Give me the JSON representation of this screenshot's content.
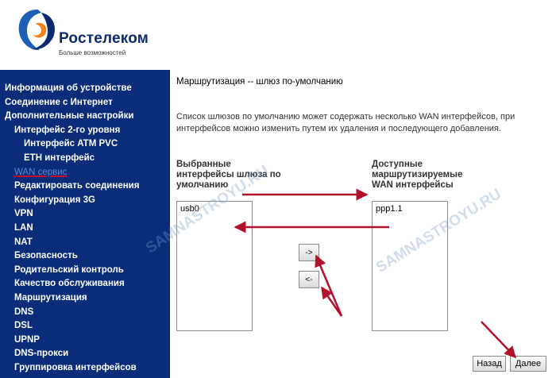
{
  "brand": {
    "name": "Ростелеком",
    "tagline": "Больше возможностей",
    "colors": {
      "blue": "#0b2a6e",
      "orange": "#f57f17",
      "sidebar": "#0a2c79",
      "accent_red": "#c8102e"
    }
  },
  "sidebar": {
    "items": [
      {
        "label": "Информация об устройстве",
        "level": 0
      },
      {
        "label": "Соединение с Интернет",
        "level": 0
      },
      {
        "label": "Дополнительные настройки",
        "level": 0
      },
      {
        "label": "Интерфейс 2-го уровня",
        "level": 1
      },
      {
        "label": "Интерфейс ATM PVC",
        "level": 2
      },
      {
        "label": "ETH интерфейс",
        "level": 2
      },
      {
        "label": "WAN сервис",
        "level": 1,
        "active": true
      },
      {
        "label": "Редактировать соединения",
        "level": 1
      },
      {
        "label": "Конфигурация 3G",
        "level": 1
      },
      {
        "label": "VPN",
        "level": 1
      },
      {
        "label": "LAN",
        "level": 1
      },
      {
        "label": "NAT",
        "level": 1
      },
      {
        "label": "Безопасность",
        "level": 1
      },
      {
        "label": "Родительский контроль",
        "level": 1
      },
      {
        "label": "Качество обслуживания",
        "level": 1
      },
      {
        "label": "Маршрутизация",
        "level": 1
      },
      {
        "label": "DNS",
        "level": 1
      },
      {
        "label": "DSL",
        "level": 1
      },
      {
        "label": "UPNP",
        "level": 1
      },
      {
        "label": "DNS-прокси",
        "level": 1
      },
      {
        "label": "Группировка интерфейсов",
        "level": 1
      }
    ]
  },
  "main": {
    "title": "Маршрутизация -- шлюз по-умолчанию",
    "description_line1": "Список шлюзов по умолчанию может содержать несколько WAN интерфейсов, при",
    "description_line2": "интерфейсов можно изменить путем их удаления и последующего добавления.",
    "selected": {
      "label_line1": "Выбранные",
      "label_line2": "интерфейсы шлюза по",
      "label_line3": "умолчанию",
      "items": [
        "usb0"
      ]
    },
    "available": {
      "label_line1": "Доступные",
      "label_line2": "маршрутизируемые",
      "label_line3": "WAN интерфейсы",
      "items": [
        "ppp1.1"
      ]
    },
    "move_add_label": "->",
    "move_remove_label": "<-",
    "back_label": "Назад",
    "next_label": "Далее"
  },
  "watermark": "SAMNASTROYU.RU"
}
